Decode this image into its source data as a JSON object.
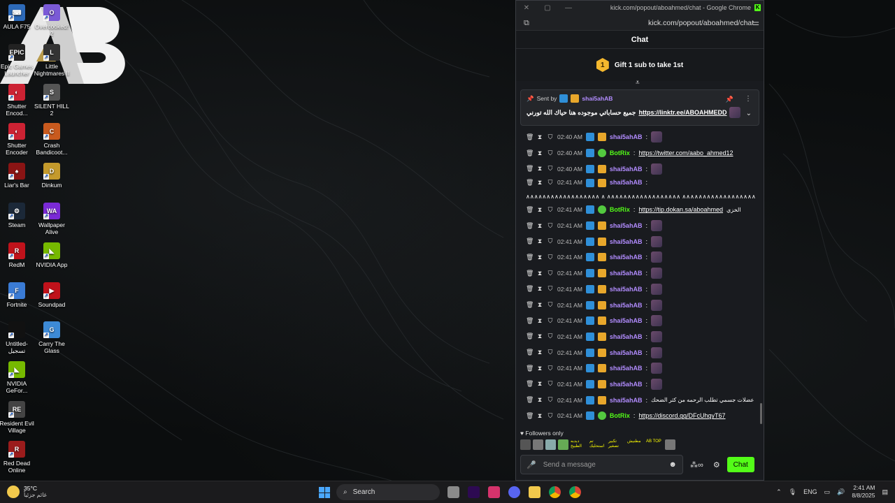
{
  "desktop": {
    "col1": [
      {
        "label": "AULA F75",
        "color": "#2d6ab8",
        "glyph": "⌨"
      },
      {
        "label": "Epic Games Launcher",
        "color": "#222",
        "glyph": "EPIC"
      },
      {
        "label": "Shutter Encod...",
        "color": "#c23",
        "glyph": "◐"
      },
      {
        "label": "Shutter Encoder",
        "color": "#c23",
        "glyph": "◐"
      },
      {
        "label": "Liar's Bar",
        "color": "#8a1414",
        "glyph": "♠"
      },
      {
        "label": "Steam",
        "color": "#1b2838",
        "glyph": "⚙"
      },
      {
        "label": "RedM",
        "color": "#c0121b",
        "glyph": "R"
      },
      {
        "label": "Fortnite",
        "color": "#3a7bd5",
        "glyph": "F"
      },
      {
        "label": "Untitled-تسجيل",
        "color": "#111",
        "glyph": ""
      },
      {
        "label": "NVIDIA GeFor...",
        "color": "#76b900",
        "glyph": "◣"
      },
      {
        "label": "Resident Evil Village",
        "color": "#444",
        "glyph": "RE"
      },
      {
        "label": "Red Dead Online",
        "color": "#9b1c1c",
        "glyph": "R"
      }
    ],
    "col2": [
      {
        "label": "Overcooked! 2",
        "color": "#7a5ad6",
        "glyph": "O"
      },
      {
        "label": "Little Nightmares II",
        "color": "#333",
        "glyph": "L"
      },
      {
        "label": "SILENT HILL 2",
        "color": "#555",
        "glyph": "S"
      },
      {
        "label": "Crash Bandicoot...",
        "color": "#c85a1e",
        "glyph": "C"
      },
      {
        "label": "Dinkum",
        "color": "#c49a2c",
        "glyph": "D"
      },
      {
        "label": "Wallpaper Alive",
        "color": "#7a2ad6",
        "glyph": "WA"
      },
      {
        "label": "NVIDIA App",
        "color": "#76b900",
        "glyph": "◣"
      },
      {
        "label": "Soundpad",
        "color": "#c0121b",
        "glyph": "▶"
      },
      {
        "label": "Carry The Glass",
        "color": "#3d8ad6",
        "glyph": "G"
      }
    ]
  },
  "window": {
    "title": "kick.com/popout/aboahmed/chat - Google Chrome",
    "url": "kick.com/popout/aboahmed/chat",
    "minimize": "—",
    "maximize": "▢",
    "close": "✕"
  },
  "chat": {
    "header": "Chat",
    "gift_badge": "1",
    "gift_text": "Gift 1 sub to take 1st",
    "pinned": {
      "sent_by_label": "Sent by",
      "user": "shai5ahAB",
      "message": "جميع حساباتي موجوده هنا حياك الله تورني",
      "link": "https://linktr.ee/ABOAHMEDD"
    },
    "messages": [
      {
        "time": "02:40 AM",
        "user": "shai5ahAB",
        "color": "#b28cff",
        "text": "",
        "link": "",
        "emote": true,
        "bot": false
      },
      {
        "time": "02:40 AM",
        "user": "BotRix",
        "color": "#53fc18",
        "text": "",
        "link": "https://twitter.com/aabo_ahmed12",
        "emote": false,
        "bot": true
      },
      {
        "time": "02:40 AM",
        "user": "shai5ahAB",
        "color": "#b28cff",
        "text": "",
        "link": "",
        "emote": true,
        "bot": false
      },
      {
        "time": "02:41 AM",
        "user": "shai5ahAB",
        "color": "#b28cff",
        "text": "∧∧∧∧∧∧∧∧∧∧∧∧∧∧∧∧∧∧ ∧ ∧∧∧∧∧∧∧∧∧∧∧∧∧∧∧∧∧∧ ∧∧∧∧∧∧∧∧∧∧∧∧∧∧∧∧∧∧",
        "link": "",
        "emote": false,
        "bot": false,
        "tall": true
      },
      {
        "time": "02:41 AM",
        "user": "BotRix",
        "color": "#53fc18",
        "text": "الخزي",
        "link": "https://tip.dokan.sa/aboahmed",
        "emote": false,
        "bot": true
      },
      {
        "time": "02:41 AM",
        "user": "shai5ahAB",
        "color": "#b28cff",
        "text": "",
        "link": "",
        "emote": true,
        "bot": false
      },
      {
        "time": "02:41 AM",
        "user": "shai5ahAB",
        "color": "#b28cff",
        "text": "",
        "link": "",
        "emote": true,
        "bot": false
      },
      {
        "time": "02:41 AM",
        "user": "shai5ahAB",
        "color": "#b28cff",
        "text": "",
        "link": "",
        "emote": true,
        "bot": false
      },
      {
        "time": "02:41 AM",
        "user": "shai5ahAB",
        "color": "#b28cff",
        "text": "",
        "link": "",
        "emote": true,
        "bot": false
      },
      {
        "time": "02:41 AM",
        "user": "shai5ahAB",
        "color": "#b28cff",
        "text": "",
        "link": "",
        "emote": true,
        "bot": false
      },
      {
        "time": "02:41 AM",
        "user": "shai5ahAB",
        "color": "#b28cff",
        "text": "",
        "link": "",
        "emote": true,
        "bot": false
      },
      {
        "time": "02:41 AM",
        "user": "shai5ahAB",
        "color": "#b28cff",
        "text": "",
        "link": "",
        "emote": true,
        "bot": false
      },
      {
        "time": "02:41 AM",
        "user": "shai5ahAB",
        "color": "#b28cff",
        "text": "",
        "link": "",
        "emote": true,
        "bot": false
      },
      {
        "time": "02:41 AM",
        "user": "shai5ahAB",
        "color": "#b28cff",
        "text": "",
        "link": "",
        "emote": true,
        "bot": false
      },
      {
        "time": "02:41 AM",
        "user": "shai5ahAB",
        "color": "#b28cff",
        "text": "",
        "link": "",
        "emote": true,
        "bot": false
      },
      {
        "time": "02:41 AM",
        "user": "shai5ahAB",
        "color": "#b28cff",
        "text": "",
        "link": "",
        "emote": true,
        "bot": false
      },
      {
        "time": "02:41 AM",
        "user": "shai5ahAB",
        "color": "#b28cff",
        "text": "عضلات جسمي تطلب الرحمه من كثر الضحك",
        "link": "",
        "emote": false,
        "bot": false
      },
      {
        "time": "02:41 AM",
        "user": "BotRix",
        "color": "#53fc18",
        "text": "",
        "link": "https://discord.gg/DFcUhgyT67",
        "emote": false,
        "bot": true
      }
    ],
    "followers_only": "Followers only",
    "emote_strip": [
      "",
      "",
      "",
      "",
      "دبدبه الطبيخ",
      "تم استحليك",
      "تكبير تصغير",
      "مطنيش",
      "AB TOP",
      ""
    ],
    "input_placeholder": "Send a message",
    "send_label": "Chat",
    "accent": "#53fc18"
  },
  "taskbar": {
    "temperature": "35°C",
    "weather_desc": "غائم جزئياً",
    "search_label": "Search",
    "language": "ENG",
    "time": "2:41 AM",
    "date": "8/8/2025"
  }
}
